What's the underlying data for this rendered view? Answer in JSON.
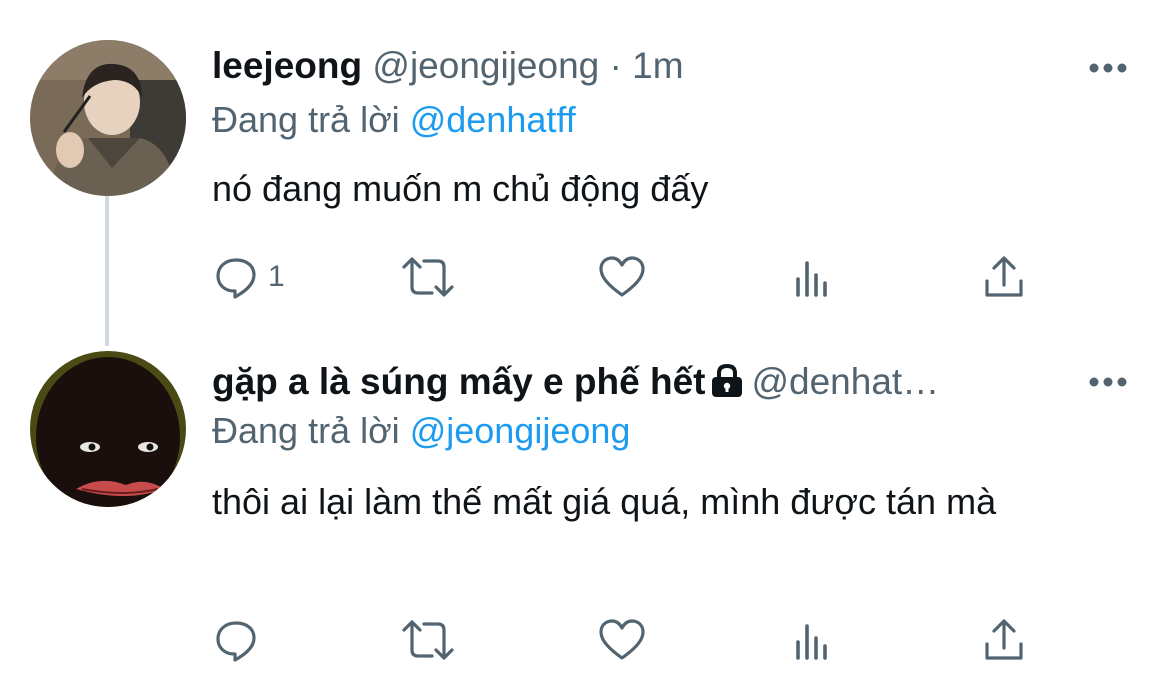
{
  "tweets": [
    {
      "display_name": "leejeong",
      "handle": "@jeongijeong",
      "separator": "·",
      "time": "1m",
      "replying_prefix": "Đang trả lời",
      "replying_to": "@denhatff",
      "text": "nó đang muốn m chủ động đấy",
      "reply_count": "1",
      "locked": false,
      "avatar_icon": "user-photo-avatar"
    },
    {
      "display_name": "gặp a là súng mấy e phế hết",
      "handle": "@denhat…",
      "replying_prefix": "Đang trả lời",
      "replying_to": "@jeongijeong",
      "text": "thôi ai lại làm thế mất giá quá, mình được tán mà",
      "reply_count": "",
      "locked": true,
      "avatar_icon": "dark-face-avatar"
    }
  ],
  "colors": {
    "text": "#0f1419",
    "secondary": "#536471",
    "accent": "#1d9bf0",
    "thread_line": "#cfd9de"
  },
  "action_icons": [
    "reply-icon",
    "retweet-icon",
    "like-icon",
    "analytics-icon",
    "share-icon"
  ]
}
